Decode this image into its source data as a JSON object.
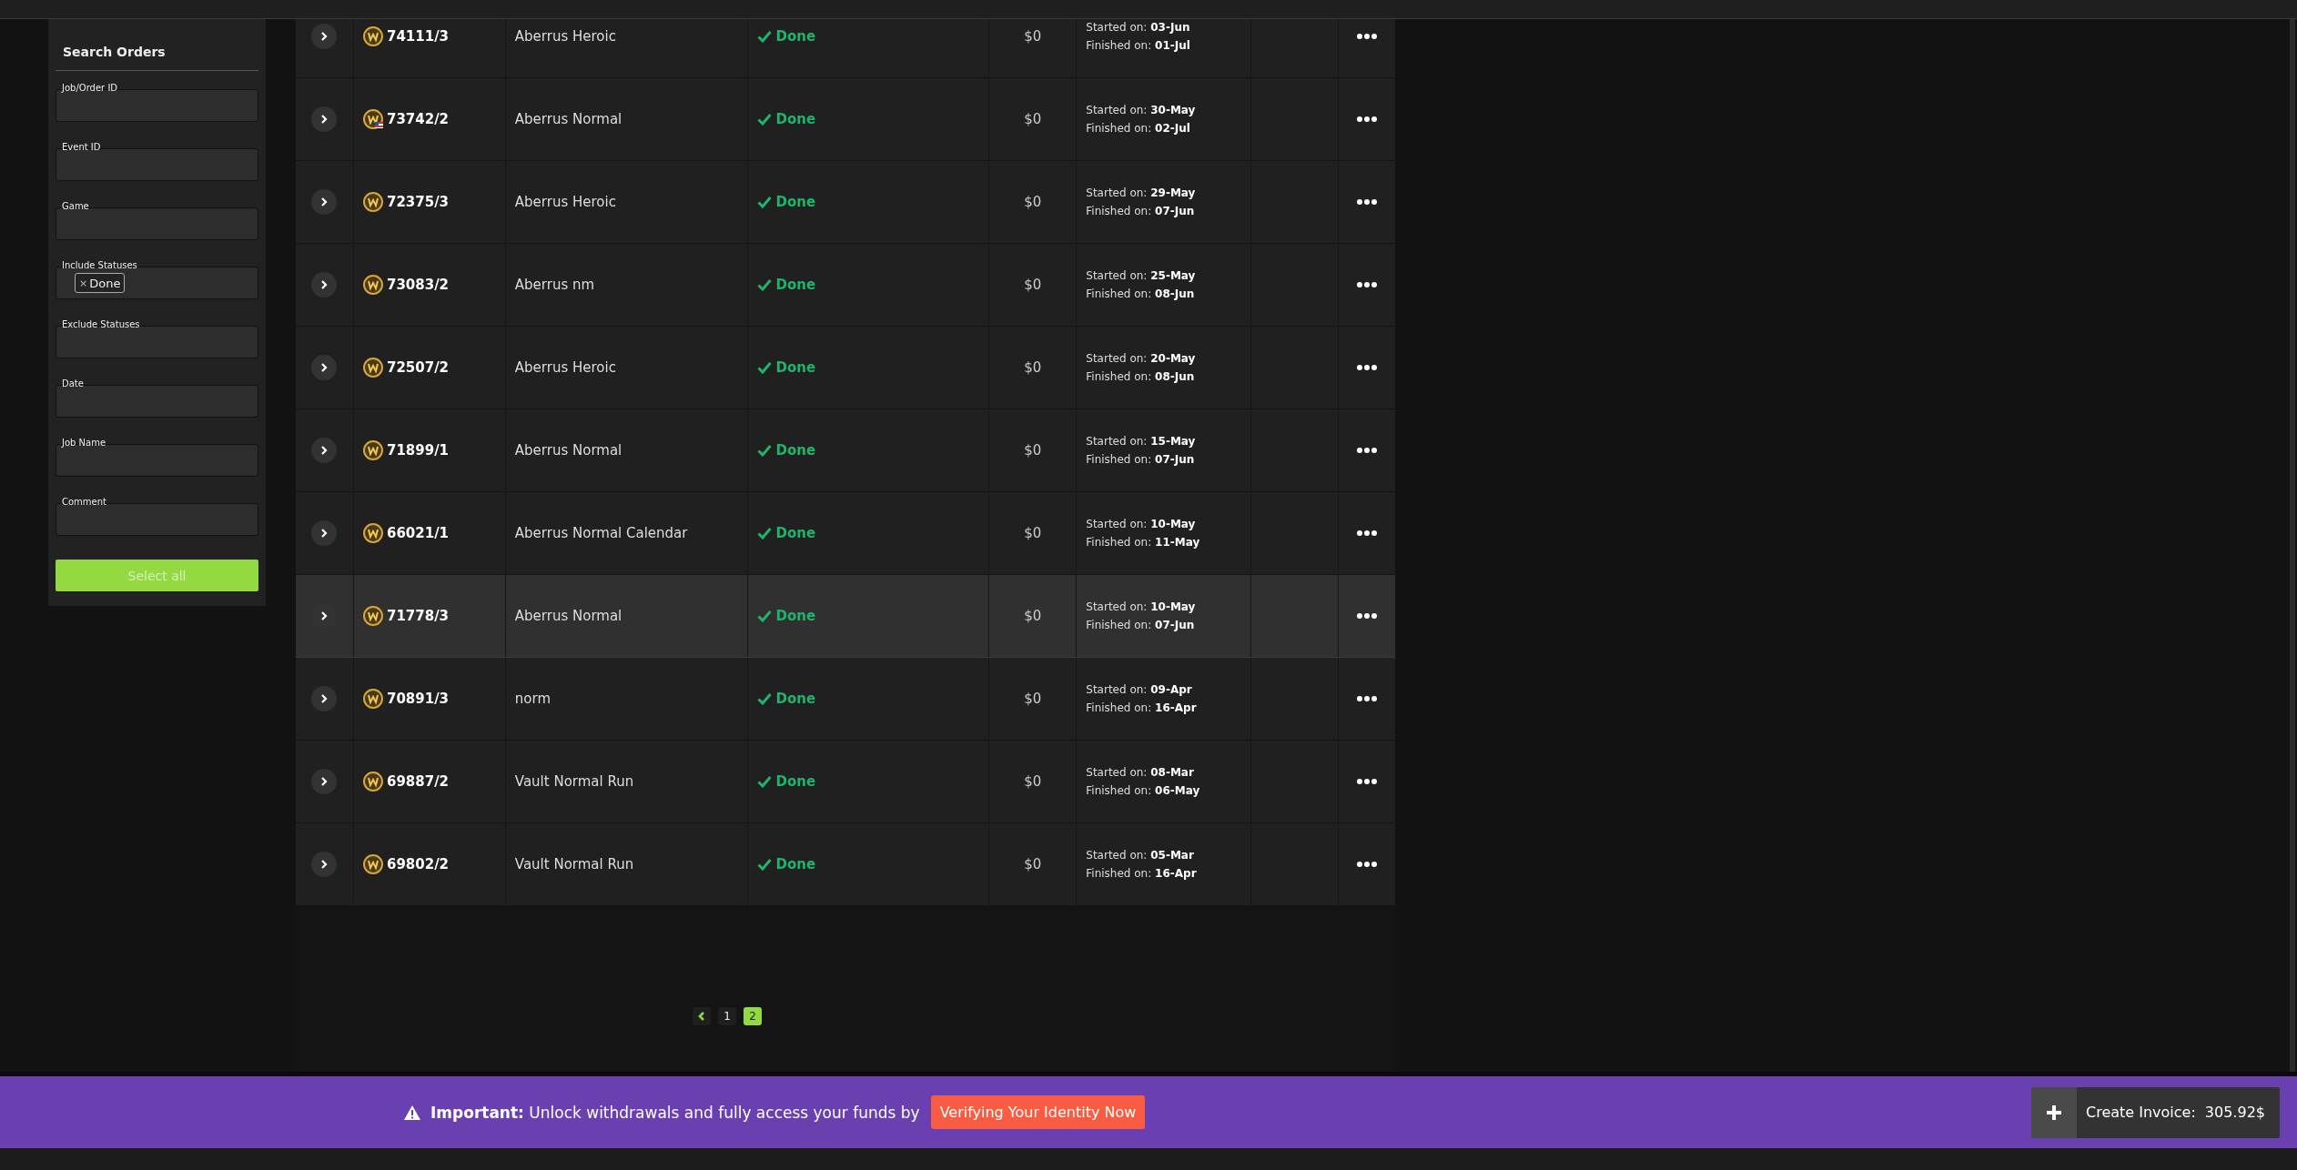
{
  "sidebar": {
    "title": "Search Orders",
    "fields": [
      {
        "label": "Job/Order ID"
      },
      {
        "label": "Event ID"
      },
      {
        "label": "Game"
      },
      {
        "label": "Include Statuses",
        "tags": [
          {
            "remove": "×",
            "text": "Done"
          }
        ]
      },
      {
        "label": "Exclude Statuses"
      },
      {
        "label": "Date"
      },
      {
        "label": "Job Name"
      },
      {
        "label": "Comment"
      }
    ],
    "button": "Select all"
  },
  "table": {
    "rows": [
      {
        "id": "74111/3",
        "flag": false,
        "name": "Aberrus Heroic",
        "status": "Done",
        "amount": "$0",
        "started": "Started on: **03-Jun**",
        "finished": "Finished on: **01-Jul**",
        "highlighted": false
      },
      {
        "id": "73742/2",
        "flag": true,
        "name": "Aberrus Normal",
        "status": "Done",
        "amount": "$0",
        "started": "Started on: **30-May**",
        "finished": "Finished on: **02-Jul**",
        "highlighted": false
      },
      {
        "id": "72375/3",
        "flag": false,
        "name": "Aberrus Heroic",
        "status": "Done",
        "amount": "$0",
        "started": "Started on: **29-May**",
        "finished": "Finished on: **07-Jun**",
        "highlighted": false
      },
      {
        "id": "73083/2",
        "flag": false,
        "name": "Aberrus nm",
        "status": "Done",
        "amount": "$0",
        "started": "Started on: **25-May**",
        "finished": "Finished on: **08-Jun**",
        "highlighted": false
      },
      {
        "id": "72507/2",
        "flag": false,
        "name": "Aberrus Heroic",
        "status": "Done",
        "amount": "$0",
        "started": "Started on: **20-May**",
        "finished": "Finished on: **08-Jun**",
        "highlighted": false
      },
      {
        "id": "71899/1",
        "flag": false,
        "name": "Aberrus Normal",
        "status": "Done",
        "amount": "$0",
        "started": "Started on: **15-May**",
        "finished": "Finished on: **07-Jun**",
        "highlighted": false
      },
      {
        "id": "66021/1",
        "flag": false,
        "name": "Aberrus Normal Calendar",
        "status": "Done",
        "amount": "$0",
        "started": "Started on: **10-May**",
        "finished": "Finished on: **11-May**",
        "highlighted": false
      },
      {
        "id": "71778/3",
        "flag": false,
        "name": "Aberrus Normal",
        "status": "Done",
        "amount": "$0",
        "started": "Started on: **10-May**",
        "finished": "Finished on: **07-Jun**",
        "highlighted": true
      },
      {
        "id": "70891/3",
        "flag": false,
        "name": "norm",
        "status": "Done",
        "amount": "$0",
        "started": "Started on: **09-Apr**",
        "finished": "Finished on: **16-Apr**",
        "highlighted": false
      },
      {
        "id": "69887/2",
        "flag": false,
        "name": "Vault Normal Run",
        "status": "Done",
        "amount": "$0",
        "started": "Started on: **08-Mar**",
        "finished": "Finished on: **06-May**",
        "highlighted": false
      },
      {
        "id": "69802/2",
        "flag": false,
        "name": "Vault Normal Run",
        "status": "Done",
        "amount": "$0",
        "started": "Started on: **05-Mar**",
        "finished": "Finished on: **16-Apr**",
        "highlighted": false
      }
    ]
  },
  "pagination": {
    "pages": [
      {
        "label": "1",
        "selected": false
      },
      {
        "label": "2",
        "selected": true
      }
    ]
  },
  "banner": {
    "message": "**Important:** Unlock withdrawals and fully access your funds by",
    "button": "Verifying Your Identity Now"
  },
  "invoice": {
    "label": "Create Invoice:",
    "amount": "305.92$"
  }
}
